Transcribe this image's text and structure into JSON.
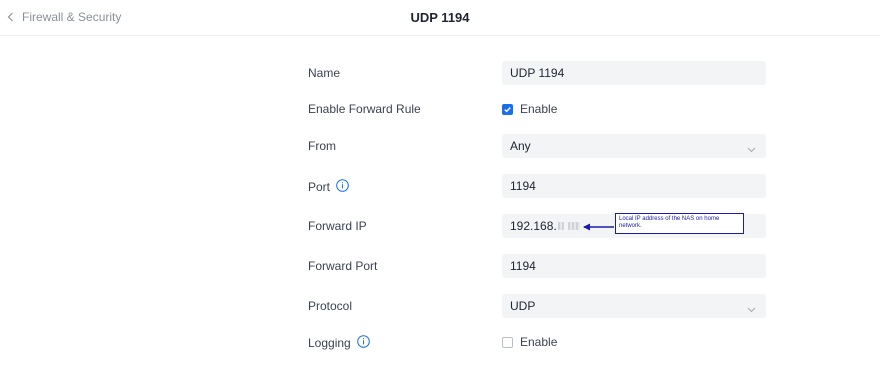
{
  "header": {
    "back_label": "Firewall & Security",
    "title": "UDP 1194"
  },
  "form": {
    "name": {
      "label": "Name",
      "value": "UDP 1194"
    },
    "enable_forward_rule": {
      "label": "Enable Forward Rule",
      "checkbox_label": "Enable",
      "checked": true
    },
    "from": {
      "label": "From",
      "value": "Any"
    },
    "port": {
      "label": "Port",
      "value": "1194"
    },
    "forward_ip": {
      "label": "Forward IP",
      "value_visible": "192.168."
    },
    "forward_port": {
      "label": "Forward Port",
      "value": "1194"
    },
    "protocol": {
      "label": "Protocol",
      "value": "UDP"
    },
    "logging": {
      "label": "Logging",
      "checkbox_label": "Enable",
      "checked": false
    }
  },
  "annotation": {
    "text": "Local IP address of the NAS on home network."
  },
  "colors": {
    "accent": "#1a6fe8",
    "field_bg": "#f3f4f6",
    "annotation": "#1b1bb3"
  },
  "icons": {
    "back": "chevron-left-icon",
    "info": "info-icon",
    "dropdown": "chevron-down-icon",
    "check": "check-icon",
    "annotation_arrow": "arrow-left-icon"
  }
}
